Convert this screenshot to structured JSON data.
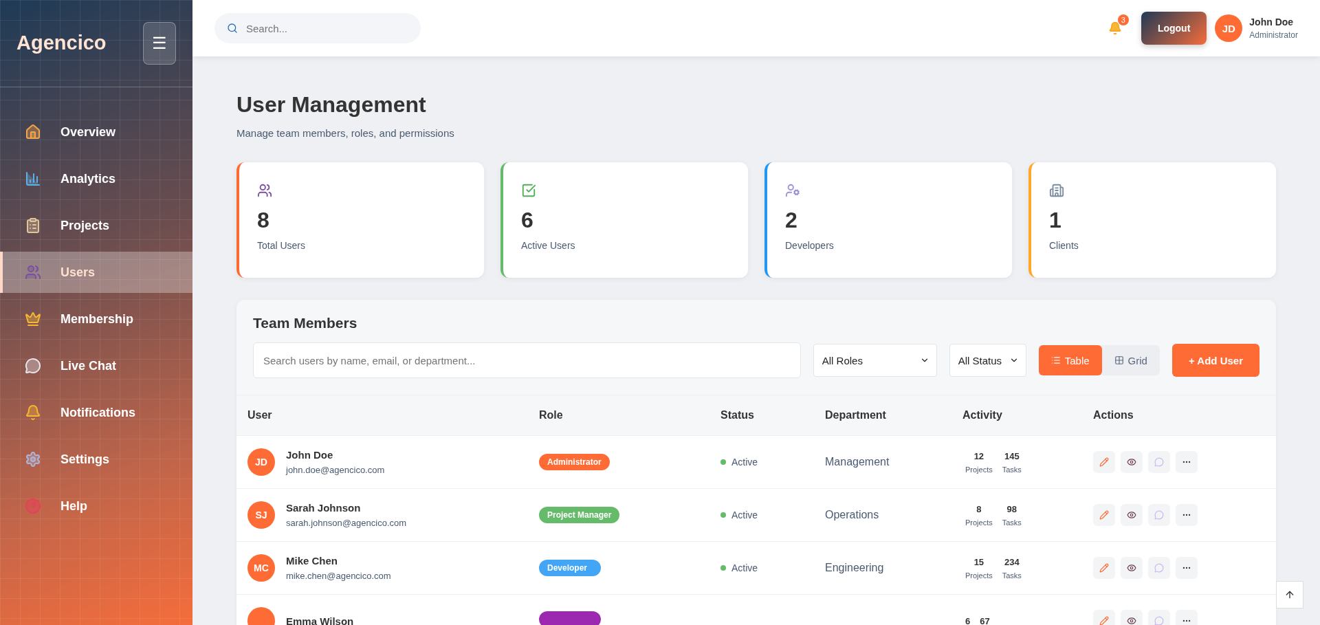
{
  "sidebar": {
    "logo": "Agencico",
    "menu_button": "☰",
    "items": [
      {
        "label": "Overview",
        "selected": false
      },
      {
        "label": "Analytics",
        "selected": false
      },
      {
        "label": "Projects",
        "selected": false
      },
      {
        "label": "Users",
        "selected": true
      },
      {
        "label": "Membership",
        "selected": false
      },
      {
        "label": "Live Chat",
        "selected": false
      },
      {
        "label": "Notifications",
        "selected": false
      },
      {
        "label": "Settings",
        "selected": false
      },
      {
        "label": "Help",
        "selected": false
      }
    ]
  },
  "topbar": {
    "search": {
      "placeholder": "Search..."
    },
    "notification_count": "3",
    "logout": "Logout",
    "user": {
      "initials": "JD",
      "name": "John Doe",
      "role": "Administrator"
    }
  },
  "page": {
    "title": "User Management",
    "subtitle": "Manage team members, roles, and permissions"
  },
  "stats": [
    {
      "value": "8",
      "label": "Total Users",
      "color": "#ff6b35"
    },
    {
      "value": "6",
      "label": "Active Users",
      "color": "#66bb6a"
    },
    {
      "value": "2",
      "label": "Developers",
      "color": "#2196f3"
    },
    {
      "value": "1",
      "label": "Clients",
      "color": "#ffa726"
    }
  ],
  "team": {
    "title": "Team Members",
    "search": {
      "placeholder": "Search users by name, email, or department..."
    },
    "role_filter": "All Roles",
    "status_filter": "All Status",
    "views": [
      {
        "label": "Table",
        "selected": true
      },
      {
        "label": "Grid",
        "selected": false
      }
    ],
    "add_button": "+ Add User",
    "columns": [
      "User",
      "Role",
      "Status",
      "Department",
      "Activity",
      "Actions"
    ],
    "rows": [
      {
        "initials": "JD",
        "name": "John Doe",
        "email": "john.doe@agencico.com",
        "role": {
          "label": "Administrator",
          "color": "#ff6b35"
        },
        "status": "Active",
        "department": "Management",
        "activity": [
          {
            "value": "12",
            "label": "Projects"
          },
          {
            "value": "145",
            "label": "Tasks"
          }
        ]
      },
      {
        "initials": "SJ",
        "name": "Sarah Johnson",
        "email": "sarah.johnson@agencico.com",
        "role": {
          "label": "Project Manager",
          "color": "#66bb6a"
        },
        "status": "Active",
        "department": "Operations",
        "activity": [
          {
            "value": "8",
            "label": "Projects"
          },
          {
            "value": "98",
            "label": "Tasks"
          }
        ]
      },
      {
        "initials": "MC",
        "name": "Mike Chen",
        "email": "mike.chen@agencico.com",
        "role": {
          "label": "Developer",
          "color": "#42a5f5"
        },
        "status": "Active",
        "department": "Engineering",
        "activity": [
          {
            "value": "15",
            "label": "Projects"
          },
          {
            "value": "234",
            "label": "Tasks"
          }
        ]
      },
      {
        "name": "Emma Wilson",
        "role": {
          "color": "#9c27b0"
        },
        "activity": [
          {
            "value": "6"
          },
          {
            "value": "67"
          }
        ]
      }
    ]
  }
}
